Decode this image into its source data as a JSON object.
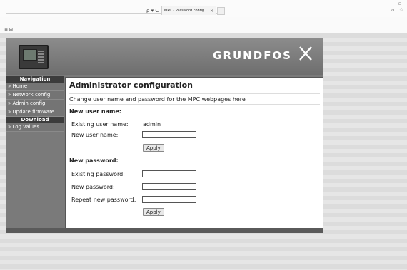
{
  "browser": {
    "tab_title": "MPC - Password config",
    "tab_close": "×",
    "addr_icons": "ρ ▾ C",
    "cmd_icons": "≡ ⊞",
    "win_min": "–",
    "win_max": "▫",
    "home_icon": "⌂",
    "star_icon": "☆"
  },
  "header": {
    "logo_text": "GRUNDFOS"
  },
  "sidebar": {
    "nav_heading": "Navigation",
    "items": [
      {
        "label": "» Home"
      },
      {
        "label": "» Network config"
      },
      {
        "label": "» Admin config"
      },
      {
        "label": "» Update firmware"
      }
    ],
    "download_heading": "Download",
    "download_items": [
      {
        "label": "» Log values"
      }
    ]
  },
  "panel": {
    "title": "Administrator configuration",
    "description": "Change user name and password for the MPC webpages here",
    "username_section": {
      "heading": "New user name:",
      "existing_label": "Existing user name:",
      "existing_value": "admin",
      "new_label": "New user name:",
      "new_value": "",
      "apply_label": "Apply"
    },
    "password_section": {
      "heading": "New password:",
      "existing_label": "Existing password:",
      "new_label": "New password:",
      "repeat_label": "Repeat new password:",
      "apply_label": "Apply"
    }
  },
  "colors": {
    "header_bg": "#7a7a7a",
    "nav_heading_bg": "#3c3c3c",
    "panel_bg": "#ffffff"
  }
}
